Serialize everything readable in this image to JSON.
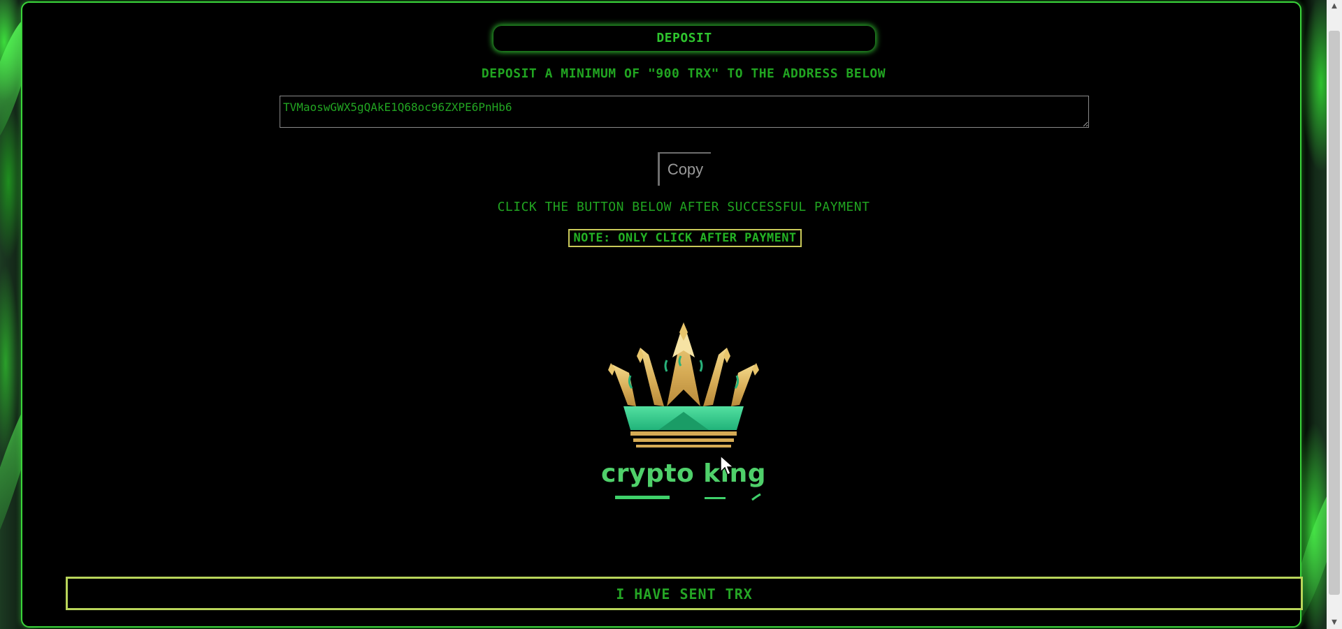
{
  "deposit": {
    "title": "DEPOSIT",
    "instruction": "DEPOSIT A MINIMUM OF \"900 TRX\" TO THE ADDRESS BELOW",
    "address": "TVMaoswGWX5gQAkE1Q68oc96ZXPE6PnHb6",
    "copy_label": "Copy",
    "after_payment_text": "CLICK THE BUTTON BELOW AFTER SUCCESSFUL PAYMENT",
    "note": "NOTE: ONLY CLICK AFTER PAYMENT"
  },
  "logo": {
    "text": "crypto king",
    "icon": "crown-icon"
  },
  "confirm": {
    "label": "I HAVE SENT TRX"
  },
  "colors": {
    "accent_green": "#21a521",
    "border_green": "#3ad43a",
    "note_border": "#c9c95a",
    "button_border": "#b9d55a",
    "gold": "#d9b45a",
    "mint": "#4fd06a"
  },
  "icons": {
    "scroll_up": "▲",
    "scroll_down": "▼"
  }
}
